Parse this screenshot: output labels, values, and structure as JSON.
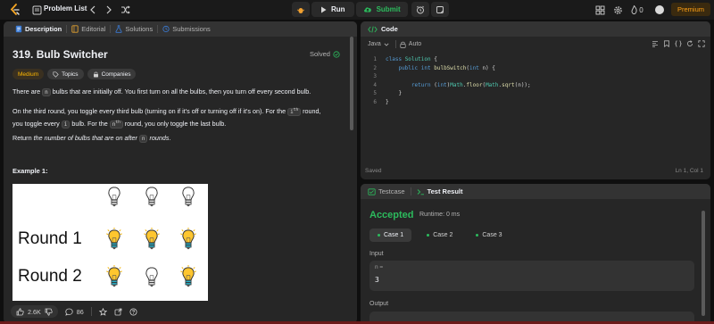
{
  "topbar": {
    "problem_list": "Problem List",
    "run_label": "Run",
    "submit_label": "Submit",
    "streak_count": "0",
    "premium_label": "Premium"
  },
  "left_tabs": [
    "Description",
    "Editorial",
    "Solutions",
    "Submissions"
  ],
  "problem": {
    "title": "319. Bulb Switcher",
    "solved_label": "Solved",
    "difficulty": "Medium",
    "topics_label": "Topics",
    "companies_label": "Companies",
    "p1_a": "There are ",
    "p1_code": "n",
    "p1_b": " bulbs that are initially off. You first turn on all the bulbs, then you turn off every second bulb.",
    "p2_a": "On the third round, you toggle every third bulb (turning on if it's off or turning off if it's on). For the ",
    "p2_code1": "i",
    "p2_sup": "th",
    "p2_b": " round,",
    "p2_c": "you toggle every ",
    "p2_code2": "i",
    "p2_d": " bulb. For the ",
    "p2_code3": "n",
    "p2_sup2": "th",
    "p2_e": " round, you only toggle the last bulb.",
    "p3_a": "Return ",
    "p3_b": "the number of bulbs that are on after",
    "p3_code": "n",
    "p3_c": " rounds",
    "p3_d": ".",
    "example_title": "Example 1:",
    "round1": "Round 1",
    "round2": "Round 2"
  },
  "stats": {
    "likes": "2.6K",
    "comments": "86"
  },
  "code": {
    "tab_label": "Code",
    "language": "Java",
    "auto_label": "Auto",
    "lines": [
      {
        "n": "1",
        "t": "class Solution {"
      },
      {
        "n": "2",
        "t": "    public int bulbSwitch(int n) {"
      },
      {
        "n": "3",
        "t": ""
      },
      {
        "n": "4",
        "t": "        return (int)Math.floor(Math.sqrt(n));"
      },
      {
        "n": "5",
        "t": "    }"
      },
      {
        "n": "6",
        "t": "}"
      }
    ],
    "saved_label": "Saved",
    "cursor_pos": "Ln 1, Col 1"
  },
  "test": {
    "testcase_tab": "Testcase",
    "result_tab": "Test Result",
    "status": "Accepted",
    "runtime": "Runtime: 0 ms",
    "cases": [
      "Case 1",
      "Case 2",
      "Case 3"
    ],
    "input_label": "Input",
    "input_key": "n =",
    "input_value": "3",
    "output_label": "Output"
  },
  "colors": {
    "accent_green": "#2cbb5d",
    "premium_orange": "#ffa116",
    "medium_yellow": "#ffb800"
  }
}
